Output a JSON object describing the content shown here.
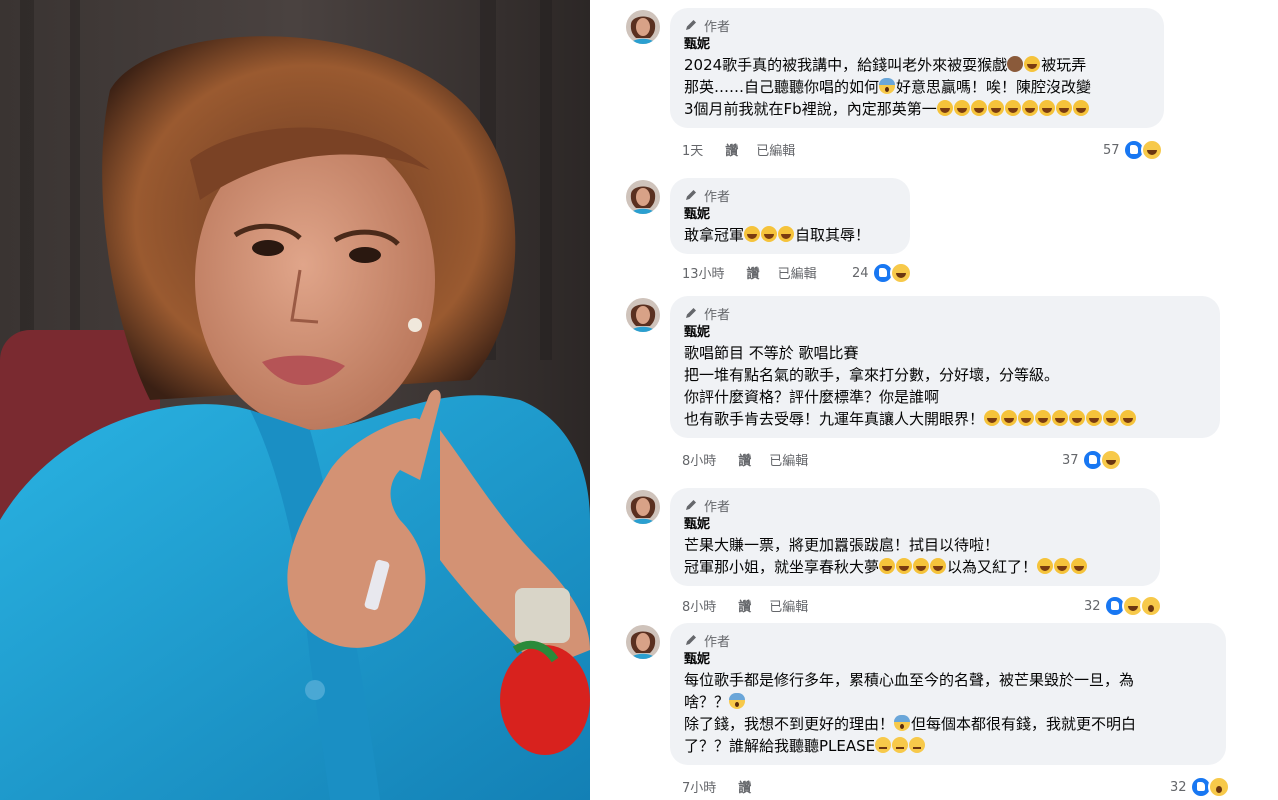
{
  "colors": {
    "like": "#1877f2",
    "bubble": "#f0f2f5",
    "meta": "#65676b",
    "coat": "#1b9fd0"
  },
  "photo": {
    "alt_subject": "woman-in-blue-coat"
  },
  "comments": [
    {
      "badge": "作者",
      "author": "甄妮",
      "lines": [
        {
          "parts": [
            {
              "t": "2024歌手真的被我講中，給錢叫老外來被耍猴戲"
            },
            {
              "e": "monkey"
            },
            {
              "e": "laugh"
            },
            {
              "t": "被玩弄"
            }
          ]
        },
        {
          "parts": [
            {
              "t": "那英……自己聽聽你唱的如何"
            },
            {
              "e": "fear"
            },
            {
              "t": "好意思贏嗎！唉！陳腔沒改變"
            }
          ]
        },
        {
          "parts": [
            {
              "t": "3個月前我就在Fb裡說，內定那英第一"
            },
            {
              "e": "laugh"
            },
            {
              "e": "laugh"
            },
            {
              "e": "laugh"
            },
            {
              "e": "laugh"
            },
            {
              "e": "laugh"
            },
            {
              "e": "laugh"
            },
            {
              "e": "laugh"
            },
            {
              "e": "laugh"
            },
            {
              "e": "laugh"
            }
          ]
        }
      ],
      "time": "1天",
      "like_label": "讚",
      "edited": "已編輯",
      "count": "57",
      "reactions": [
        "like",
        "haha"
      ]
    },
    {
      "badge": "作者",
      "author": "甄妮",
      "lines": [
        {
          "parts": [
            {
              "t": "敢拿冠軍"
            },
            {
              "e": "laugh"
            },
            {
              "e": "laugh"
            },
            {
              "e": "laugh"
            },
            {
              "t": "自取其辱！"
            }
          ]
        }
      ],
      "time": "13小時",
      "like_label": "讚",
      "edited": "已編輯",
      "count": "24",
      "reactions": [
        "like",
        "haha"
      ]
    },
    {
      "badge": "作者",
      "author": "甄妮",
      "lines": [
        {
          "parts": [
            {
              "t": "歌唱節目 不等於 歌唱比賽"
            }
          ]
        },
        {
          "parts": [
            {
              "t": "把一堆有點名氣的歌手，拿來打分數，分好壞，分等級。"
            }
          ]
        },
        {
          "parts": [
            {
              "t": "你評什麼資格？評什麼標準？你是誰啊"
            }
          ]
        },
        {
          "parts": [
            {
              "t": "也有歌手肯去受辱！九運年真讓人大開眼界！"
            },
            {
              "e": "laugh"
            },
            {
              "e": "laugh"
            },
            {
              "e": "laugh"
            },
            {
              "e": "laugh"
            },
            {
              "e": "laugh"
            },
            {
              "e": "laugh"
            },
            {
              "e": "laugh"
            },
            {
              "e": "laugh"
            },
            {
              "e": "laugh"
            }
          ]
        }
      ],
      "time": "8小時",
      "like_label": "讚",
      "edited": "已編輯",
      "count": "37",
      "reactions": [
        "like",
        "haha"
      ]
    },
    {
      "badge": "作者",
      "author": "甄妮",
      "lines": [
        {
          "parts": [
            {
              "t": "芒果大賺一票，將更加囂張跋扈！拭目以待啦！"
            }
          ]
        },
        {
          "parts": [
            {
              "t": "冠軍那小姐，就坐享春秋大夢"
            },
            {
              "e": "laugh"
            },
            {
              "e": "laugh"
            },
            {
              "e": "laugh"
            },
            {
              "e": "laugh"
            },
            {
              "t": "以為又紅了！"
            },
            {
              "e": "laugh"
            },
            {
              "e": "laugh"
            },
            {
              "e": "laugh"
            }
          ]
        }
      ],
      "time": "8小時",
      "like_label": "讚",
      "edited": "已編輯",
      "count": "32",
      "reactions": [
        "like",
        "haha",
        "wow"
      ]
    },
    {
      "badge": "作者",
      "author": "甄妮",
      "lines": [
        {
          "parts": [
            {
              "t": "每位歌手都是修行多年，累積心血至今的名聲，被芒果毀於一旦，為"
            }
          ]
        },
        {
          "parts": [
            {
              "t": "啥？？"
            },
            {
              "e": "fear"
            }
          ]
        },
        {
          "parts": [
            {
              "t": "除了錢，我想不到更好的理由！"
            },
            {
              "e": "fear"
            },
            {
              "t": "但每個本都很有錢，我就更不明白"
            }
          ]
        },
        {
          "parts": [
            {
              "t": "了？？誰解給我聽聽PLEASE"
            },
            {
              "e": "smirk"
            },
            {
              "e": "smirk"
            },
            {
              "e": "smirk"
            }
          ]
        }
      ],
      "time": "7小時",
      "like_label": "讚",
      "edited": "",
      "count": "32",
      "reactions": [
        "like",
        "wow"
      ]
    }
  ]
}
